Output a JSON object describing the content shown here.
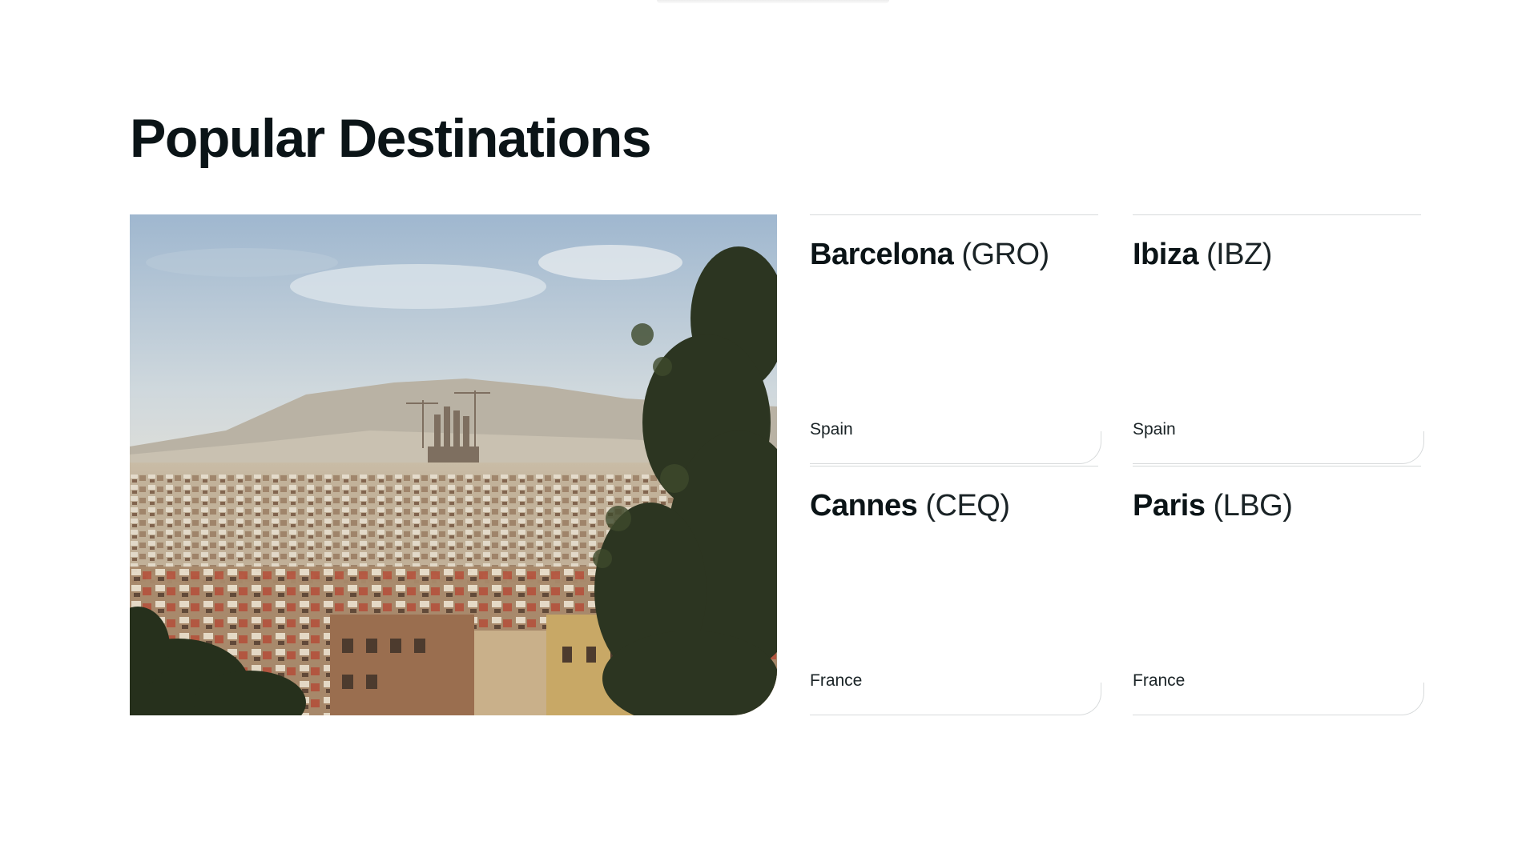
{
  "section": {
    "title": "Popular Destinations"
  },
  "hero_image": {
    "alt": "Barcelona skyline"
  },
  "destinations": [
    {
      "city": "Barcelona",
      "code": "(GRO)",
      "country": "Spain"
    },
    {
      "city": "Ibiza",
      "code": "(IBZ)",
      "country": "Spain"
    },
    {
      "city": "Cannes",
      "code": "(CEQ)",
      "country": "France"
    },
    {
      "city": "Paris",
      "code": "(LBG)",
      "country": "France"
    }
  ]
}
